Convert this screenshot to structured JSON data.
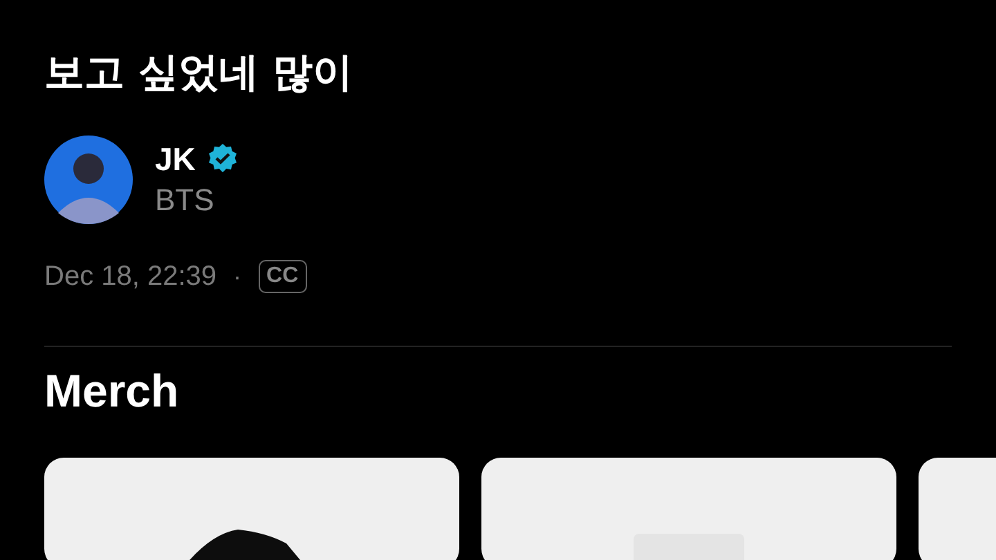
{
  "title": "보고 싶었네 많이",
  "artist": {
    "name": "JK",
    "verified": true,
    "group": "BTS"
  },
  "meta": {
    "date": "Dec 18, 22:39",
    "separator": "·",
    "caption_badge": "CC"
  },
  "merch": {
    "heading": "Merch"
  }
}
